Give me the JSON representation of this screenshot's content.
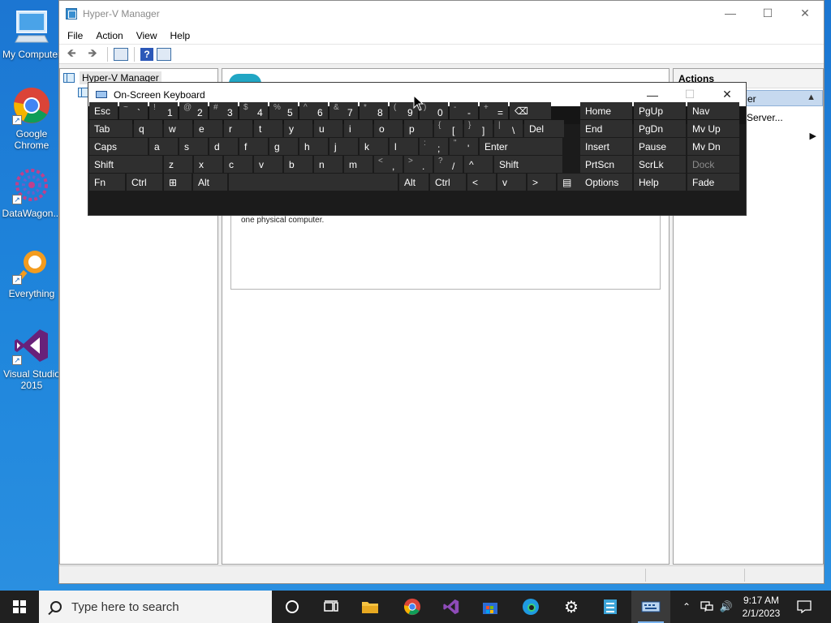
{
  "desktop": {
    "icons": [
      {
        "label": "My Computer",
        "icon": "computer-icon"
      },
      {
        "label": "Google Chrome",
        "icon": "chrome-icon"
      },
      {
        "label": "DataWagon...",
        "icon": "datawagon-icon"
      },
      {
        "label": "Everything",
        "icon": "everything-icon"
      },
      {
        "label": "Visual Studio 2015",
        "icon": "visual-studio-icon"
      }
    ]
  },
  "hyperv": {
    "title": "Hyper-V Manager",
    "menu": [
      "File",
      "Action",
      "View",
      "Help"
    ],
    "tree": {
      "root": "Hyper-V Manager"
    },
    "info_text": "one physical computer.",
    "actions": {
      "header": "Actions",
      "selected_suffix": "er",
      "item1": "Server..."
    }
  },
  "osk": {
    "title": "On-Screen Keyboard",
    "rows": [
      [
        {
          "t": "Esc"
        },
        {
          "u": "~",
          "d": "`"
        },
        {
          "u": "!",
          "d": "1"
        },
        {
          "u": "@",
          "d": "2"
        },
        {
          "u": "#",
          "d": "3"
        },
        {
          "u": "$",
          "d": "4"
        },
        {
          "u": "%",
          "d": "5"
        },
        {
          "u": "^",
          "d": "6"
        },
        {
          "u": "&",
          "d": "7"
        },
        {
          "u": "*",
          "d": "8"
        },
        {
          "u": "(",
          "d": "9"
        },
        {
          "u": ")",
          "d": "0"
        },
        {
          "u": "-",
          "d": "-"
        },
        {
          "u": "+",
          "d": "="
        },
        {
          "t": "⌫"
        },
        {
          "t": "Home"
        },
        {
          "t": "PgUp"
        },
        {
          "t": "Nav"
        }
      ],
      [
        {
          "t": "Tab"
        },
        {
          "t": "q"
        },
        {
          "t": "w"
        },
        {
          "t": "e"
        },
        {
          "t": "r"
        },
        {
          "t": "t"
        },
        {
          "t": "y"
        },
        {
          "t": "u"
        },
        {
          "t": "i"
        },
        {
          "t": "o"
        },
        {
          "t": "p"
        },
        {
          "u": "{",
          "d": "["
        },
        {
          "u": "}",
          "d": "]"
        },
        {
          "u": "|",
          "d": "\\"
        },
        {
          "t": "Del"
        },
        {
          "t": "End"
        },
        {
          "t": "PgDn"
        },
        {
          "t": "Mv Up"
        }
      ],
      [
        {
          "t": "Caps"
        },
        {
          "t": "a"
        },
        {
          "t": "s"
        },
        {
          "t": "d"
        },
        {
          "t": "f"
        },
        {
          "t": "g"
        },
        {
          "t": "h"
        },
        {
          "t": "j"
        },
        {
          "t": "k"
        },
        {
          "t": "l"
        },
        {
          "u": ":",
          "d": ";"
        },
        {
          "u": "\"",
          "d": "'"
        },
        {
          "t": "Enter"
        },
        {
          "t": "Insert"
        },
        {
          "t": "Pause"
        },
        {
          "t": "Mv Dn"
        }
      ],
      [
        {
          "t": "Shift"
        },
        {
          "t": "z"
        },
        {
          "t": "x"
        },
        {
          "t": "c"
        },
        {
          "t": "v"
        },
        {
          "t": "b"
        },
        {
          "t": "n"
        },
        {
          "t": "m"
        },
        {
          "u": "<",
          "d": ","
        },
        {
          "u": ">",
          "d": "."
        },
        {
          "u": "?",
          "d": "/"
        },
        {
          "t": "^"
        },
        {
          "t": "Shift"
        },
        {
          "t": "PrtScn"
        },
        {
          "t": "ScrLk"
        },
        {
          "t": "Dock",
          "dim": true
        }
      ],
      [
        {
          "t": "Fn"
        },
        {
          "t": "Ctrl"
        },
        {
          "t": "⊞"
        },
        {
          "t": "Alt"
        },
        {
          "t": ""
        },
        {
          "t": "Alt"
        },
        {
          "t": "Ctrl"
        },
        {
          "t": "<"
        },
        {
          "t": "v"
        },
        {
          "t": ">"
        },
        {
          "t": "▤"
        },
        {
          "t": "Options"
        },
        {
          "t": "Help"
        },
        {
          "t": "Fade"
        }
      ]
    ]
  },
  "taskbar": {
    "search_placeholder": "Type here to search",
    "time": "9:17 AM",
    "date": "2/1/2023"
  }
}
